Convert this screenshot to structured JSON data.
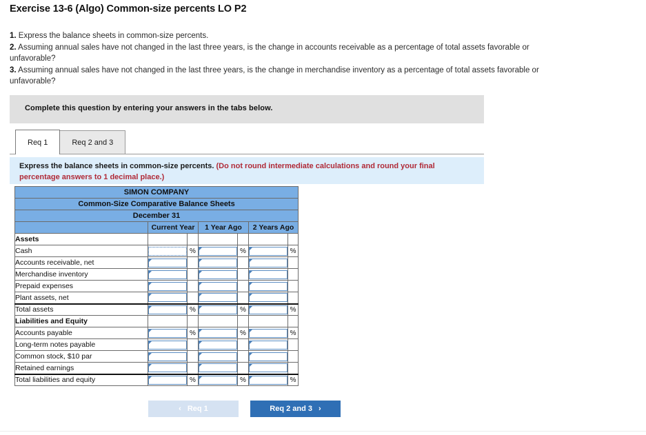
{
  "exercise": {
    "title": "Exercise 13-6 (Algo) Common-size percents LO P2"
  },
  "questions": [
    {
      "num": "1.",
      "text": " Express the balance sheets in common-size percents."
    },
    {
      "num": "2.",
      "text": " Assuming annual sales have not changed in the last three years, is the change in accounts receivable as a percentage of total assets favorable or unfavorable?"
    },
    {
      "num": "3.",
      "text": " Assuming annual sales have not changed in the last three years, is the change in merchandise inventory as a percentage of total assets favorable or unfavorable?"
    }
  ],
  "banner": {
    "text": "Complete this question by entering your answers in the tabs below."
  },
  "tabs": [
    {
      "label": "Req 1",
      "active": true
    },
    {
      "label": "Req 2 and 3",
      "active": false
    }
  ],
  "instruction": {
    "main": "Express the balance sheets in common-size percents. ",
    "note": "(Do not round intermediate calculations and round your final percentage answers to 1 decimal place.)"
  },
  "table": {
    "company": "SIMON COMPANY",
    "statement": "Common-Size Comparative Balance Sheets",
    "date": "December 31",
    "columns": [
      "Current Year",
      "1 Year Ago",
      "2 Years Ago"
    ],
    "percent_symbol": "%",
    "rows": [
      {
        "label": "Assets",
        "type": "section",
        "inputs": false,
        "percent": false
      },
      {
        "label": "Cash",
        "type": "item",
        "inputs": true,
        "percent": true,
        "focused": true
      },
      {
        "label": "Accounts receivable, net",
        "type": "item",
        "inputs": true,
        "percent": false
      },
      {
        "label": "Merchandise inventory",
        "type": "item",
        "inputs": true,
        "percent": false
      },
      {
        "label": "Prepaid expenses",
        "type": "item",
        "inputs": true,
        "percent": false
      },
      {
        "label": "Plant assets, net",
        "type": "item",
        "inputs": true,
        "percent": false
      },
      {
        "label": "Total assets",
        "type": "total",
        "inputs": true,
        "percent": true
      },
      {
        "label": "Liabilities and Equity",
        "type": "section",
        "inputs": false,
        "percent": false
      },
      {
        "label": "Accounts payable",
        "type": "item",
        "inputs": true,
        "percent": true
      },
      {
        "label": "Long-term notes payable",
        "type": "item",
        "inputs": true,
        "percent": false
      },
      {
        "label": "Common stock, $10 par",
        "type": "item",
        "inputs": true,
        "percent": false
      },
      {
        "label": "Retained earnings",
        "type": "item",
        "inputs": true,
        "percent": false
      },
      {
        "label": "Total liabilities and equity",
        "type": "total",
        "inputs": true,
        "percent": true
      }
    ]
  },
  "nav": {
    "prev_label": "Req 1",
    "prev_chevron": "‹",
    "next_label": "Req 2 and 3",
    "next_chevron": "›"
  },
  "colors": {
    "table_header_blue": "#79aee4",
    "instruction_band_blue": "#ddeefb",
    "note_red": "#b02a37",
    "primary_button_blue": "#2f6fb5",
    "disabled_button_blue": "#d5e2f2",
    "banner_gray": "#e0e0e0"
  }
}
